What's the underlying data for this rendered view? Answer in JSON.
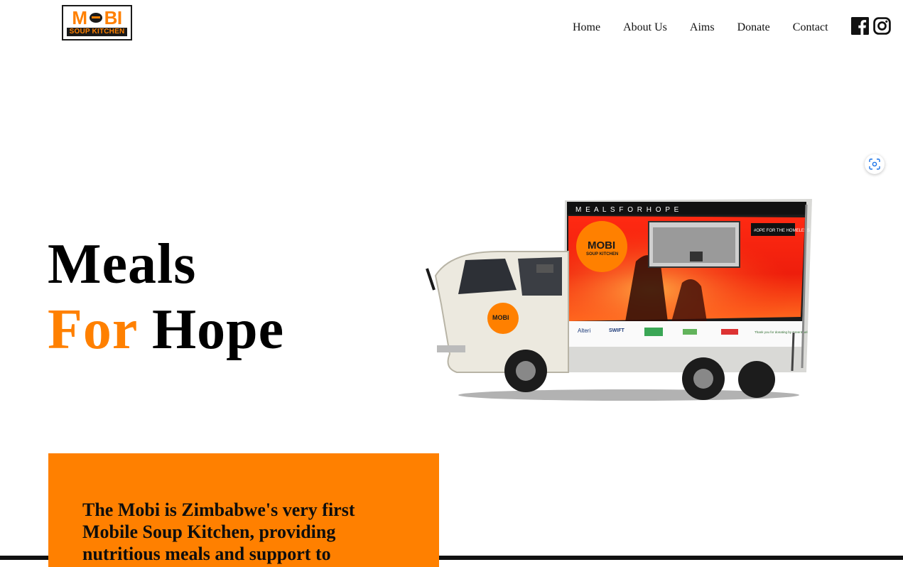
{
  "brand": {
    "logo_word_left": "M",
    "logo_word_right": "BI",
    "logo_sub": "SOUP KITCHEN",
    "accent_color": "#ff8000",
    "dark_color": "#1a1a1a"
  },
  "nav": {
    "items": [
      {
        "label": "Home"
      },
      {
        "label": "About Us"
      },
      {
        "label": "Aims"
      },
      {
        "label": "Donate"
      },
      {
        "label": "Contact"
      }
    ]
  },
  "social": {
    "icons": [
      "facebook-icon",
      "instagram-icon"
    ]
  },
  "utility": {
    "icon": "visual-search-icon"
  },
  "hero": {
    "line1": "Meals",
    "line2_accent": "For",
    "line2_rest": " Hope"
  },
  "truck": {
    "box_banner": "M E A L S   F O R   H O P E",
    "box_tag": "#OPE FOR THE HOMELESS",
    "logo_word": "MOBI",
    "logo_sub": "SOUP KITCHEN",
    "sponsors": [
      "Alteri",
      "SWIFT",
      "Thank you for donating by GreenFuel"
    ]
  },
  "intro": {
    "text": "The Mobi is Zimbabwe's very first Mobile Soup Kitchen, providing nutritious meals and support to"
  }
}
